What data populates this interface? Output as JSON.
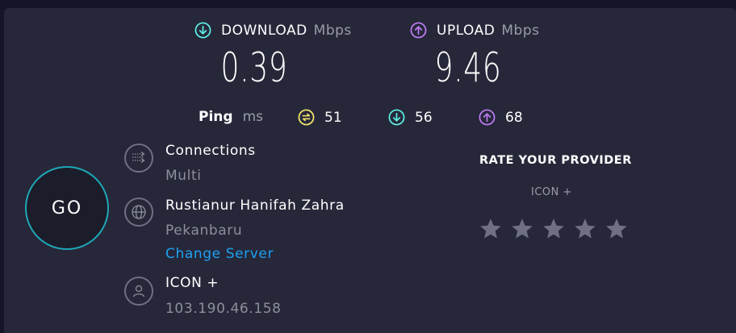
{
  "download": {
    "label": "DOWNLOAD",
    "unit": "Mbps",
    "value": "0.39"
  },
  "upload": {
    "label": "UPLOAD",
    "unit": "Mbps",
    "value": "9.46"
  },
  "ping": {
    "label": "Ping",
    "unit": "ms",
    "idle": "51",
    "download": "56",
    "upload": "68"
  },
  "go_label": "GO",
  "connections": {
    "title": "Connections",
    "value": "Multi"
  },
  "server": {
    "name": "Rustianur Hanifah Zahra",
    "location": "Pekanbaru",
    "change_label": "Change Server"
  },
  "provider": {
    "name": "ICON +",
    "ip": "103.190.46.158"
  },
  "rate": {
    "title": "RATE YOUR PROVIDER",
    "provider_name": "ICON +",
    "stars_total": 5,
    "stars_selected": 0
  },
  "colors": {
    "download_accent": "#5ff0e6",
    "upload_accent": "#c07cf5",
    "ping_accent": "#f6e96b",
    "go_ring": "#1fa7b5",
    "link": "#1da1f2",
    "star": "#6f7182"
  },
  "icons": {
    "download": "arrow-down-circle-icon",
    "upload": "arrow-up-circle-icon",
    "ping": "jitter-circle-icon",
    "connections": "connections-icon",
    "server": "globe-icon",
    "provider": "user-icon",
    "star": "star-icon"
  }
}
